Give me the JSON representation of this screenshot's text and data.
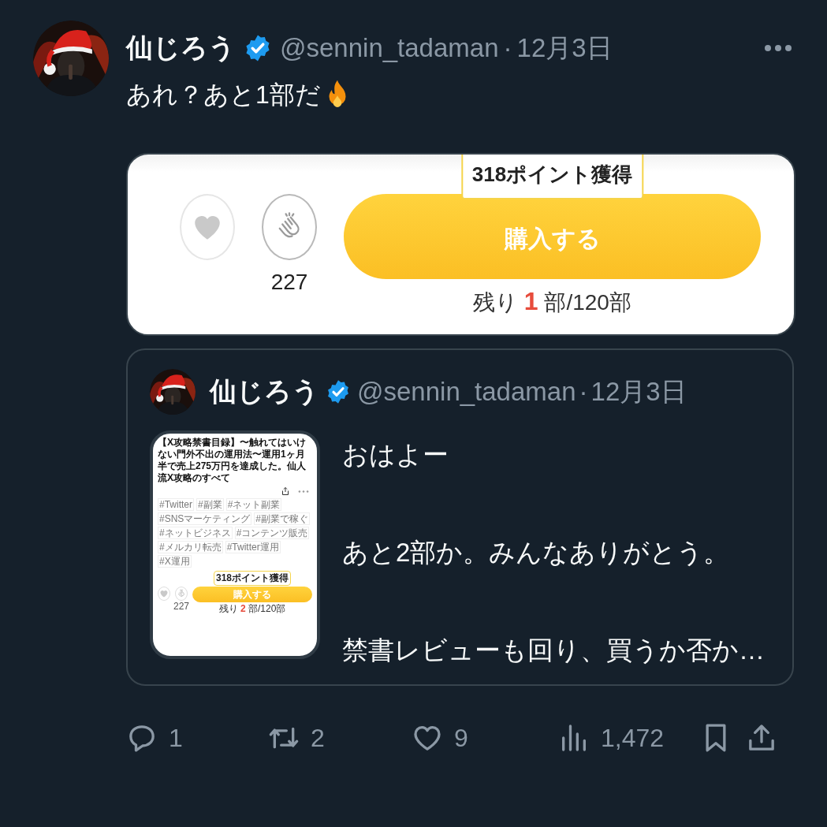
{
  "tweet": {
    "display_name": "仙じろう",
    "verified": true,
    "handle": "@sennin_tadaman",
    "separator": "·",
    "date": "12月3日",
    "text": "あれ？あと1部だ"
  },
  "image_card": {
    "clap_count": "227",
    "tooltip": "318ポイント獲得",
    "buy_button": "購入する",
    "remaining": "残り **1** 部/120部"
  },
  "quote": {
    "display_name": "仙じろう",
    "verified": true,
    "handle": "@sennin_tadaman",
    "separator": "·",
    "date": "12月3日",
    "thumbnail": {
      "title": "【X攻略禁書目録】〜触れてはいけない門外不出の運用法〜運用1ヶ月半で売上275万円を達成した。仙人流X攻略のすべて",
      "tags": [
        "#Twitter",
        "#副業",
        "#ネット副業",
        "#SNSマーケティング",
        "#副業で稼ぐ",
        "#ネットビジネス",
        "#コンテンツ販売",
        "#メルカリ転売",
        "#Twitter運用",
        "#X運用"
      ],
      "clap_count": "227",
      "tooltip": "318ポイント獲得",
      "buy_button": "購入する",
      "remaining": "残り **2** 部/120部"
    },
    "paragraphs": [
      "おはよー",
      "あと2部か。みんなありがとう。",
      "禁書レビューも回り、買うか否か…"
    ]
  },
  "actions": [
    {
      "kind": "reply",
      "count": "1"
    },
    {
      "kind": "repost",
      "count": "2"
    },
    {
      "kind": "like",
      "count": "9"
    },
    {
      "kind": "views",
      "count": "1,472"
    },
    {
      "kind": "bookmark"
    },
    {
      "kind": "share"
    }
  ]
}
